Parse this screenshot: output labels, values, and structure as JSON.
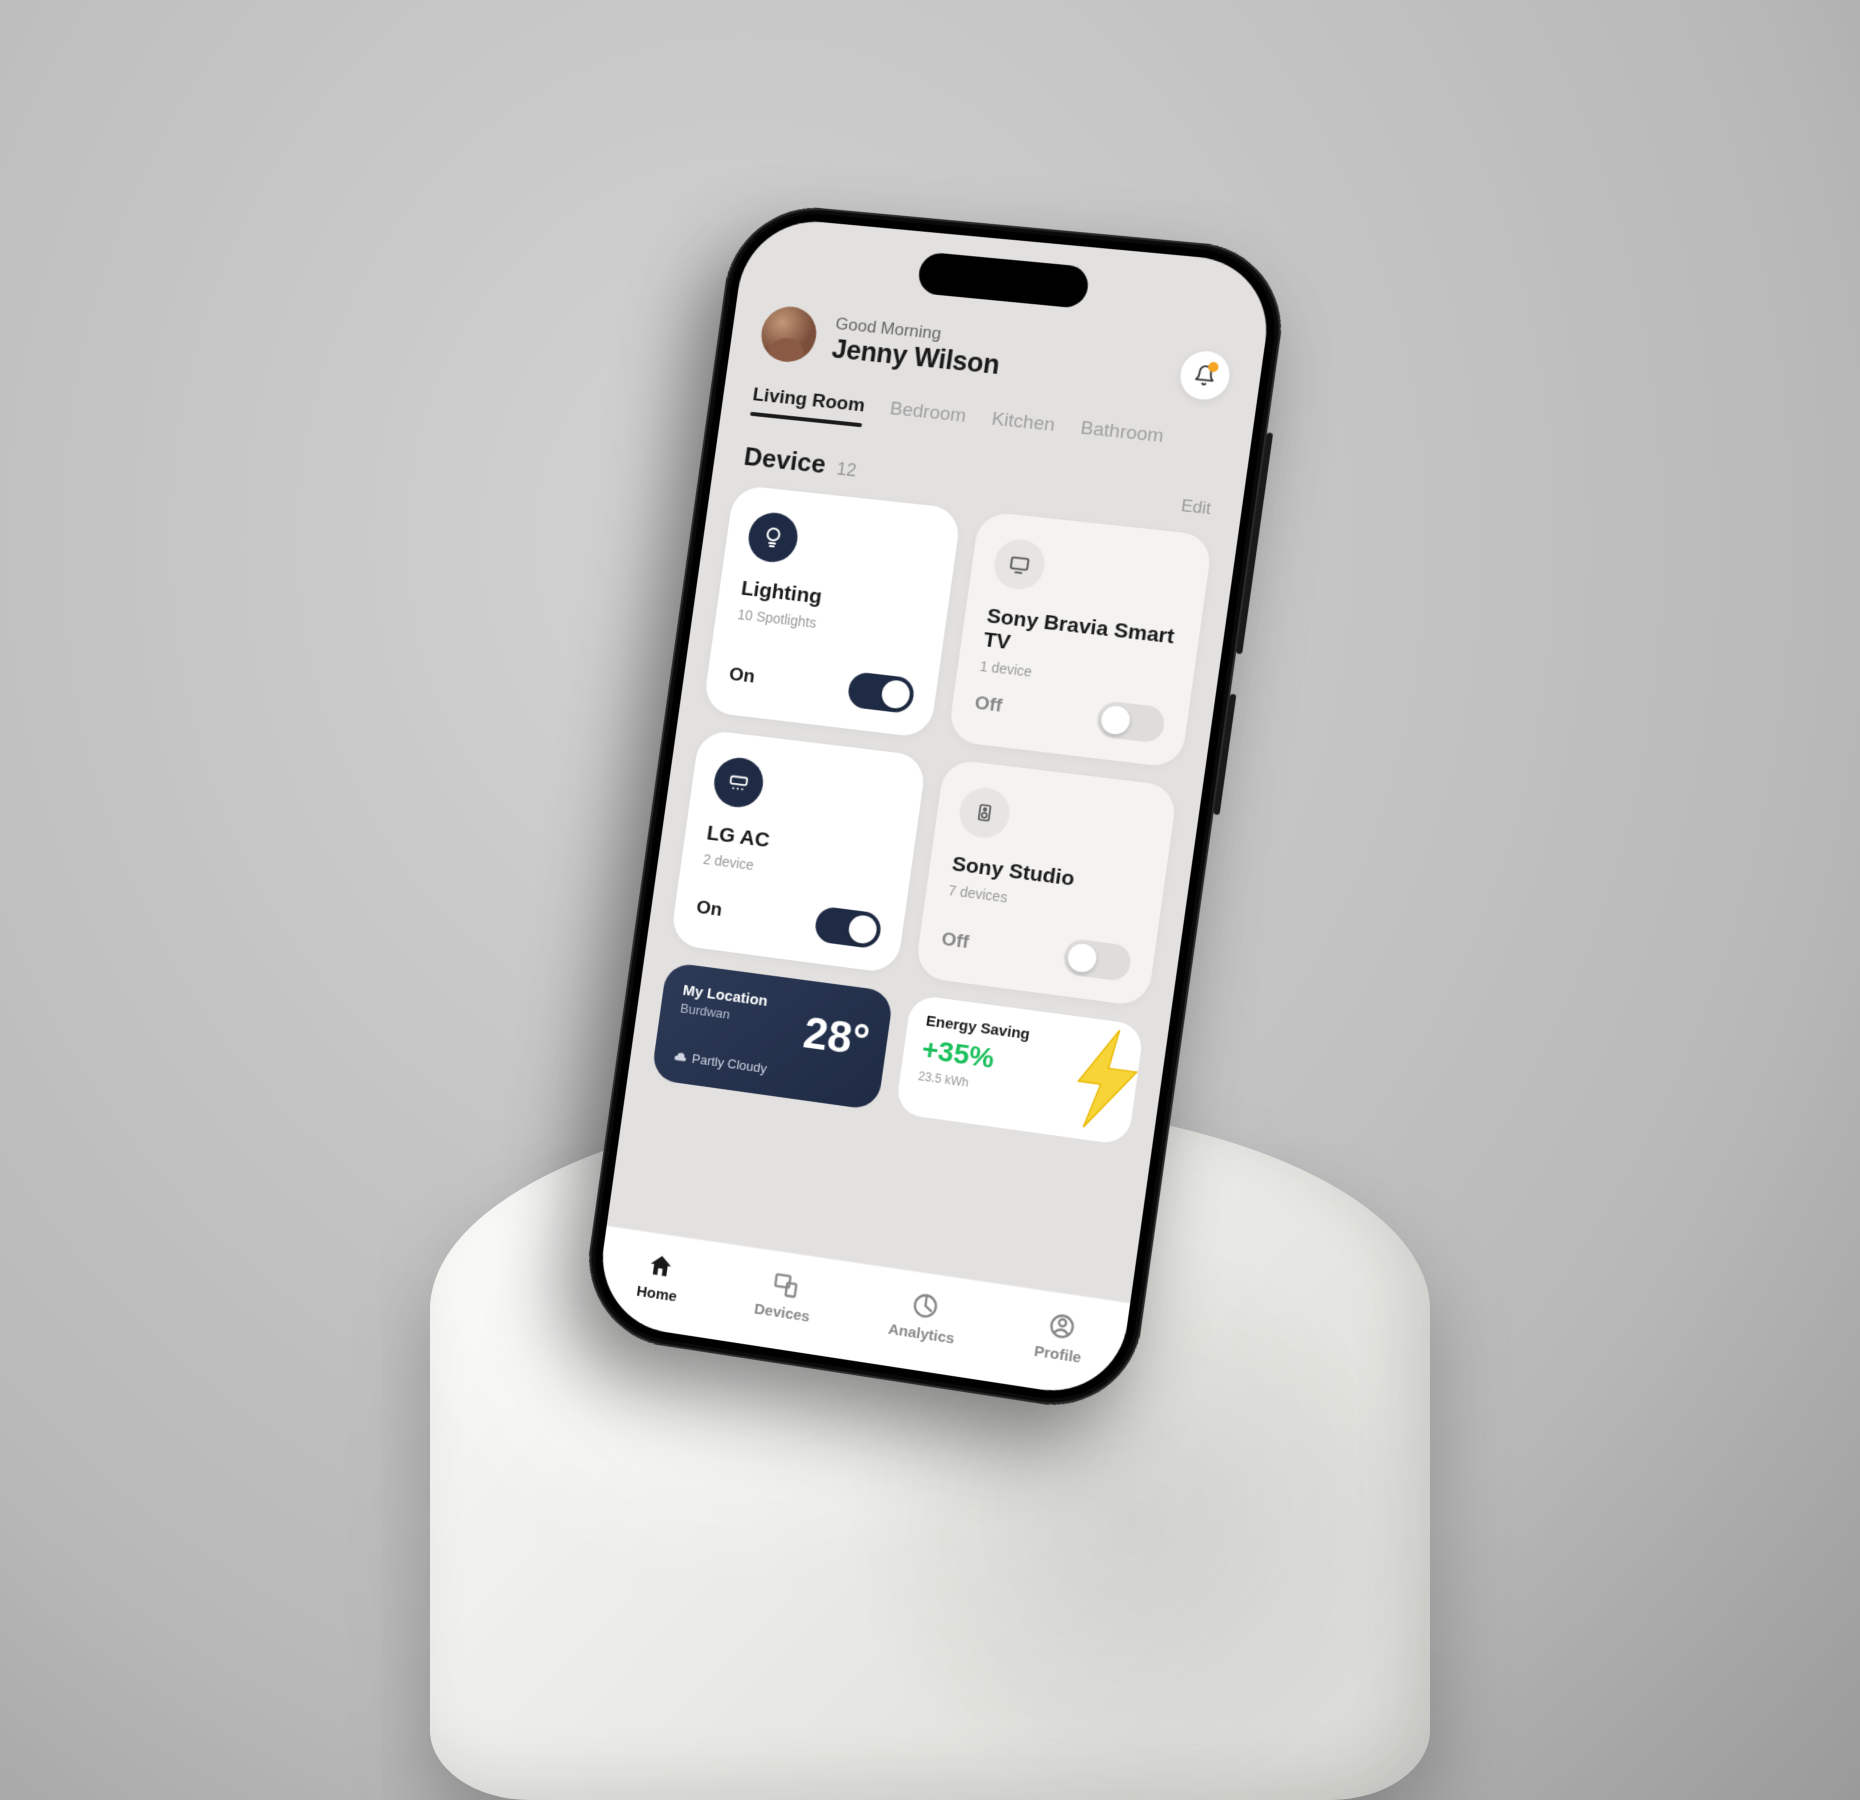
{
  "header": {
    "greeting": "Good Morning",
    "user_name": "Jenny Wilson"
  },
  "tabs": {
    "items": [
      "Living Room",
      "Bedroom",
      "Kitchen",
      "Bathroom"
    ],
    "active_index": 0
  },
  "device_section": {
    "title": "Device",
    "count": "12",
    "edit_label": "Edit"
  },
  "devices": [
    {
      "name": "Lighting",
      "subtitle": "10 Spotlights",
      "state_label": "On",
      "on": true,
      "icon": "bulb"
    },
    {
      "name": "Sony Bravia Smart TV",
      "subtitle": "1 device",
      "state_label": "Off",
      "on": false,
      "icon": "tv"
    },
    {
      "name": "LG AC",
      "subtitle": "2 device",
      "state_label": "On",
      "on": true,
      "icon": "ac"
    },
    {
      "name": "Sony Studio",
      "subtitle": "7 devices",
      "state_label": "Off",
      "on": false,
      "icon": "speaker"
    }
  ],
  "weather": {
    "location_label": "My Location",
    "city": "Burdwan",
    "temperature": "28°",
    "condition": "Partly Cloudy"
  },
  "energy": {
    "label": "Energy Saving",
    "percent": "+35%",
    "usage": "23.5 kWh"
  },
  "nav": {
    "items": [
      "Home",
      "Devices",
      "Analytics",
      "Profile"
    ],
    "active_index": 0
  },
  "colors": {
    "accent_dark": "#1f2b44",
    "positive": "#1bbf5c",
    "warn": "#f5a623"
  }
}
